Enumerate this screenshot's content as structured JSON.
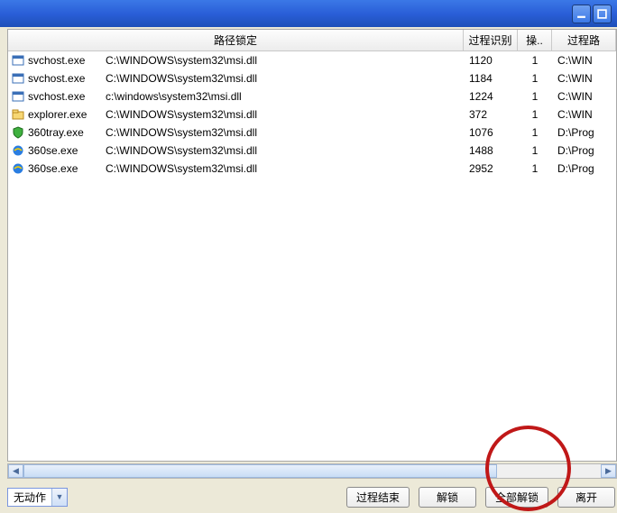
{
  "titlebar": {
    "minimize_name": "minimize-icon",
    "maximize_name": "maximize-icon"
  },
  "columns": {
    "path": "路径锁定",
    "pid": "过程识别",
    "op": "操..",
    "proc": "过程路"
  },
  "rows": [
    {
      "icon": "window",
      "name": "svchost.exe",
      "path": "C:\\WINDOWS\\system32\\msi.dll",
      "pid": "1120",
      "op": "1",
      "proc": "C:\\WIN"
    },
    {
      "icon": "window",
      "name": "svchost.exe",
      "path": "C:\\WINDOWS\\system32\\msi.dll",
      "pid": "1184",
      "op": "1",
      "proc": "C:\\WIN"
    },
    {
      "icon": "window",
      "name": "svchost.exe",
      "path": "c:\\windows\\system32\\msi.dll",
      "pid": "1224",
      "op": "1",
      "proc": "C:\\WIN"
    },
    {
      "icon": "folder",
      "name": "explorer.exe",
      "path": "C:\\WINDOWS\\system32\\msi.dll",
      "pid": "372",
      "op": "1",
      "proc": "C:\\WIN"
    },
    {
      "icon": "shield",
      "name": "360tray.exe",
      "path": "C:\\WINDOWS\\system32\\msi.dll",
      "pid": "1076",
      "op": "1",
      "proc": "D:\\Prog"
    },
    {
      "icon": "ie",
      "name": "360se.exe",
      "path": "C:\\WINDOWS\\system32\\msi.dll",
      "pid": "1488",
      "op": "1",
      "proc": "D:\\Prog"
    },
    {
      "icon": "ie",
      "name": "360se.exe",
      "path": "C:\\WINDOWS\\system32\\msi.dll",
      "pid": "2952",
      "op": "1",
      "proc": "D:\\Prog"
    }
  ],
  "action_select": {
    "label": "无动作"
  },
  "buttons": {
    "end_process": "过程结束",
    "unlock": "解锁",
    "unlock_all": "全部解锁",
    "leave": "离开"
  }
}
